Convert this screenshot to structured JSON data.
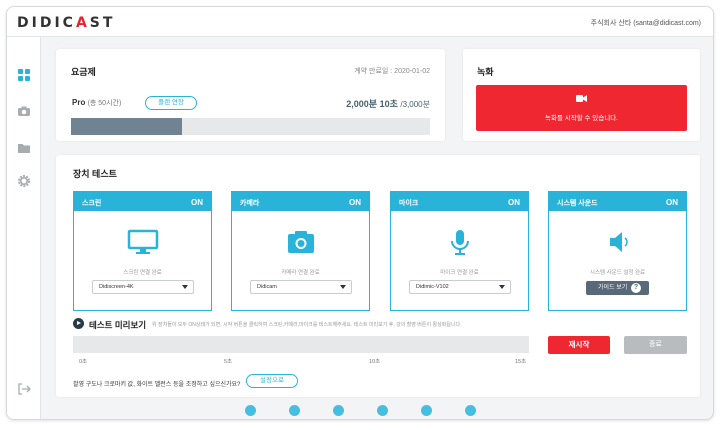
{
  "app": {
    "logo_prefix": "DIDIC",
    "logo_mark": "A",
    "logo_suffix": "ST",
    "account": "주식회사 산타 (santa@didicast.com)"
  },
  "sidebar": {
    "items": [
      {
        "icon": "dashboard-icon"
      },
      {
        "icon": "camera-icon"
      },
      {
        "icon": "folder-icon"
      },
      {
        "icon": "gear-icon"
      },
      {
        "icon": "logout-icon"
      }
    ]
  },
  "plan": {
    "title": "요금제",
    "contract_end": "계약 만료일 : 2020-01-02",
    "name": "Pro",
    "name_sub": "(총 50시간)",
    "extend_label": "플랜 연장",
    "used": "2,000분 10초",
    "total": "/3,000분",
    "usage_fraction": 0.31
  },
  "record": {
    "title": "녹화",
    "message": "녹화를 시작할 수 있습니다.",
    "color": "#ee2731"
  },
  "devices": {
    "title": "장치 테스트",
    "accent_color": "#29b3d8",
    "tiles": [
      {
        "name": "스크린",
        "state": "ON",
        "icon": "monitor-icon",
        "status": "스크린 연결 완료",
        "selected": "Didiscreen-4K"
      },
      {
        "name": "카메라",
        "state": "ON",
        "icon": "camera-icon",
        "status": "카메라 연결 완료",
        "selected": "Didicam"
      },
      {
        "name": "마이크",
        "state": "ON",
        "icon": "microphone-icon",
        "status": "마이크 연결 완료",
        "selected": "Didimic-V102"
      },
      {
        "name": "시스템 사운드",
        "state": "ON",
        "icon": "speaker-icon",
        "status": "시스템 사운드 설정 완료",
        "guide_label": "가이드 보기"
      }
    ]
  },
  "preview": {
    "title": "테스트 미리보기",
    "description": "위 장치들이 모두 ON상태가 되면, 시작 버튼을 클릭하여 스크린,카메라,마이크를 테스트해주세요. 테스트 미리보기 후, 강의 촬영 버튼이 활성화됩니다.",
    "ticks": [
      "0초",
      "5초",
      "10초",
      "15초"
    ],
    "restart_label": "재시작",
    "stop_label": "종료",
    "settings_note": "촬영 구도나 크로마키 값, 화이트 밸런스 등을 조정하고 싶으신가요?",
    "settings_label": "설정으로"
  },
  "pager": {
    "count": 6,
    "color": "#45bfe1"
  }
}
